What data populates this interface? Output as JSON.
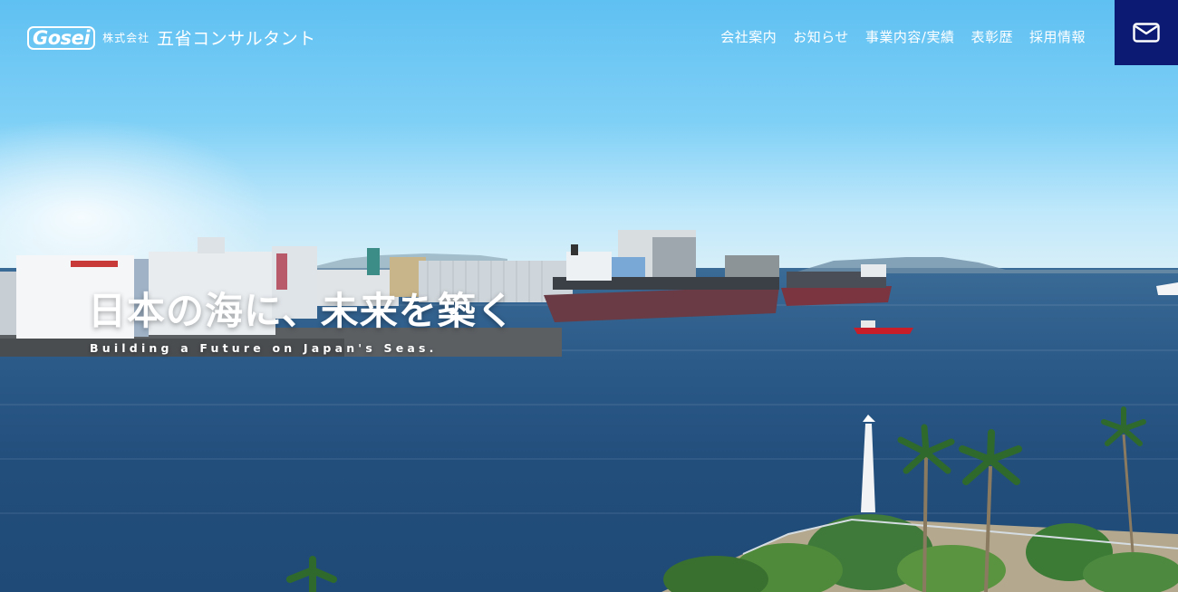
{
  "header": {
    "logo_mark": "Gosei",
    "logo_kabushiki": "株式会社",
    "company_name": "五省コンサルタント",
    "nav": [
      {
        "label": "会社案内"
      },
      {
        "label": "お知らせ"
      },
      {
        "label": "事業内容/実績"
      },
      {
        "label": "表彰歴"
      },
      {
        "label": "採用情報"
      }
    ],
    "contact_icon": "mail-icon"
  },
  "hero": {
    "title": "日本の海に、未来を築く",
    "subtitle": "Building a Future on Japan's Seas."
  },
  "colors": {
    "contact_button": "#0d1a73",
    "text": "#ffffff",
    "sea": "#224e7c",
    "sky": "#6fc6f0"
  }
}
